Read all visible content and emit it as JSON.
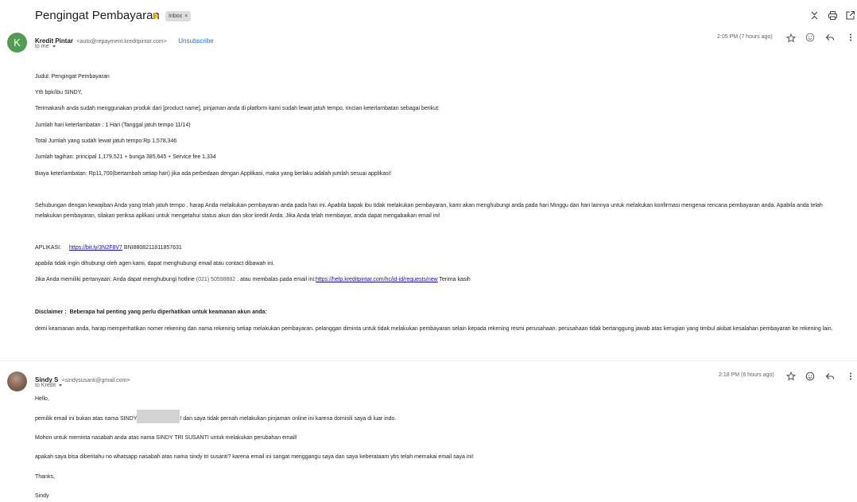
{
  "thread": {
    "subject": "Pengingat Pembayaran",
    "label": "Inbox",
    "label_close": "×"
  },
  "icons": {
    "important": "importance-marker-icon",
    "collapse": "collapse-all-icon",
    "print": "print-icon",
    "new_window": "open-in-new-window-icon",
    "star": "star-icon",
    "emoji": "emoji-reaction-icon",
    "reply": "reply-icon",
    "more": "more-vertical-icon"
  },
  "message1": {
    "avatar_letter": "K",
    "sender_name": "Kredit Pintar",
    "sender_email": "<auto@repayment.kreditpintar.com>",
    "unsubscribe": "Unsubscribe",
    "to": "to me",
    "time": "2:05 PM (7 hours ago)",
    "lines": {
      "l1": "Judul: Pengingat Pembayaran",
      "l2": "Yth bpk/ibu SINDY,",
      "l3": "Terimakasih anda sudah menggunakan produk dari [product name], pinjaman anda di platform kami sudah lewat jatuh tempo, rincian keterlambatan sebagai berikut:",
      "l4": "Jumlah hari keterlambatan : 1 Hari (Tanggal jatuh tempo 11/14)",
      "l5": "Total Jumlah yang sudah lewat jatuh tempo:Rp 1,578,346",
      "l6": "Jumlah tagihan: principal 1,179,521 + bunga 385,645 + Service fee 1,334",
      "l7": "Biaya keterlambatan: Rp11,700(bertambah setiap hari) jika ada perbedaan dengan Applikasi, maka yang berlaku adalah jumlah sesuai applikasi!",
      "p1": "Sehubungan dengan kewajiban Anda yang telah jatuh tempo , harap Anda melakukan pembayaran anda pada hari ini. Apabila bapak ibu tidak melakukan pembayaran, kami akan menghubungi anda pada hari Minggu dan hari lainnya untuk melakukan konfirmasi mengenai rencana pembayaran anda. Apabila anda telah melakukan pembayaran, silakan periksa aplikasi untuk mengetahui status akun dan skor kredit Anda. Jika Anda telah membayar, anda dapat mengabaikan email ini!",
      "app_label": "APLIKASI:",
      "app_link": "https://bit.ly/3N2F8V7",
      "app_code": "BNI8808211811857631",
      "l8": "apabila tidak ingin dihubungi oleh agen kami, dapat menghubungi email atau contact dibawah ini.",
      "l9_pre": "Jika Anda memiliki pertanyaan: Anda dapat menghubungi hotline",
      "hotline": "(021) 50598882",
      "l9_mid": ". atau membalas pada email ini:",
      "help_link": "https://help.kreditpintar.com/hc/id-id/requests/new",
      "l9_post": " Terima kasih",
      "disclaimer": "Disclaimer :  Beberapa hal penting yang perlu diperhatikan untuk keamanan akun anda:",
      "p2": "demi keamanan anda, harap memperhatikan nomer rekening dan nama rekening setiap melakukan pembayaran. pelanggan diminta untuk tidak melakukan pembayaran selain kepada rekening resmi perusahaan. perusahaan tidak bertanggung jawab atas kerugian yang timbul akibat kesalahan pembayaran ke rekening lain."
    }
  },
  "message2": {
    "sender_name": "Sindy S",
    "sender_email": "<sindysusanti@gmail.com>",
    "to": "to Kredit",
    "time": "2:18 PM (6 hours ago)",
    "lines": {
      "greeting": "Hello,",
      "l1_pre": "pemilik email ini bukan atas nama SINDY",
      "l1_post": "! dan saya tidak pernah melakukan pinjaman online ini karena domisili saya di luar indo.",
      "l2": "Mohon untuk meminta nasabah anda atas nama SINDY TRI SUSANTI untuk melakukan perubahan email!",
      "l3": "apakah saya bisa diberitahu no whatsapp nasabah atas nama sindy tri susanti? karena email ini sangat menggangu saya dan saya keberataam ybs telah memakai email saya ini!",
      "thanks": "Thanks,",
      "sign": "Sindy"
    }
  }
}
